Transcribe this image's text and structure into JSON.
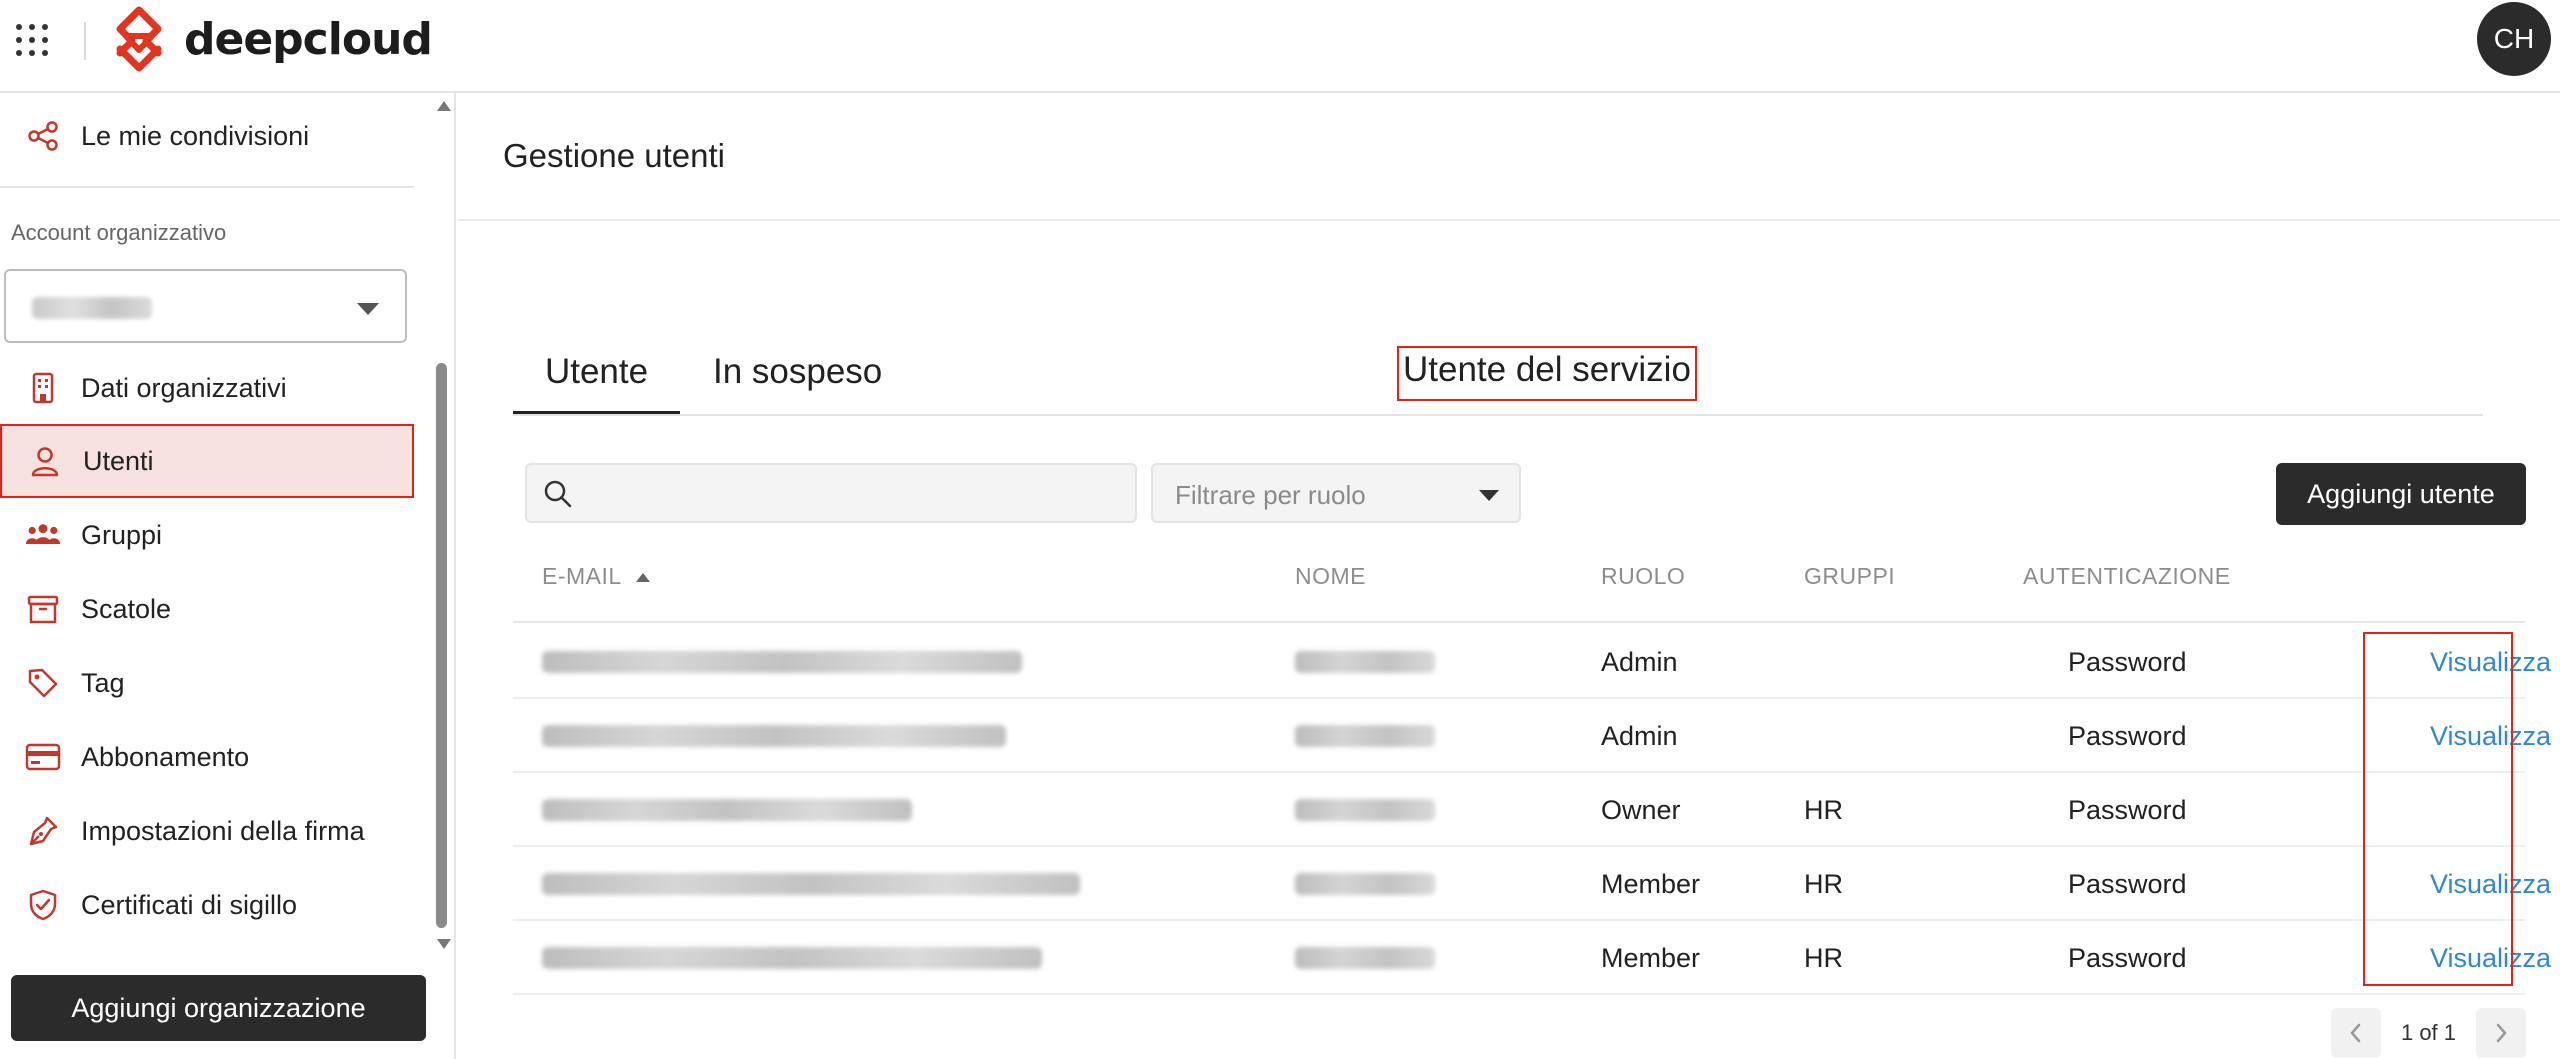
{
  "app": {
    "logo_text": "deepcloud",
    "brand_color": "#e2351f",
    "avatar_initials": "CH"
  },
  "sidebar": {
    "shares_label": "Le mie condivisioni",
    "account_label": "Account organizzativo",
    "org_select_value": "",
    "items": [
      {
        "label": "Dati organizzativi",
        "icon": "building-icon"
      },
      {
        "label": "Utenti",
        "icon": "user-icon",
        "active": true
      },
      {
        "label": "Gruppi",
        "icon": "group-icon"
      },
      {
        "label": "Scatole",
        "icon": "archive-box-icon"
      },
      {
        "label": "Tag",
        "icon": "tag-icon"
      },
      {
        "label": "Abbonamento",
        "icon": "credit-card-icon"
      },
      {
        "label": "Impostazioni della firma",
        "icon": "pen-icon"
      },
      {
        "label": "Certificati di sigillo",
        "icon": "shield-check-icon"
      }
    ],
    "add_org_label": "Aggiungi organizzazione"
  },
  "main": {
    "title": "Gestione utenti",
    "tabs": [
      {
        "label": "Utente"
      },
      {
        "label": "In sospeso"
      },
      {
        "label": "Utente del servizio"
      }
    ],
    "search": {
      "placeholder": "",
      "value": ""
    },
    "role_filter": {
      "placeholder": "Filtrare per ruolo"
    },
    "add_user_label": "Aggiungi utente",
    "columns": {
      "email": "E-MAIL",
      "name": "NOME",
      "role": "RUOLO",
      "groups": "GRUPPI",
      "auth": "AUTENTICAZIONE"
    },
    "rows": [
      {
        "role": "Admin",
        "groups": "",
        "auth": "Password",
        "action": "Visualizza"
      },
      {
        "role": "Admin",
        "groups": "",
        "auth": "Password",
        "action": "Visualizza"
      },
      {
        "role": "Owner",
        "groups": "HR",
        "auth": "Password",
        "action": ""
      },
      {
        "role": "Member",
        "groups": "HR",
        "auth": "Password",
        "action": "Visualizza"
      },
      {
        "role": "Member",
        "groups": "HR",
        "auth": "Password",
        "action": "Visualizza"
      }
    ],
    "pagination": {
      "text": "1 of 1"
    }
  }
}
